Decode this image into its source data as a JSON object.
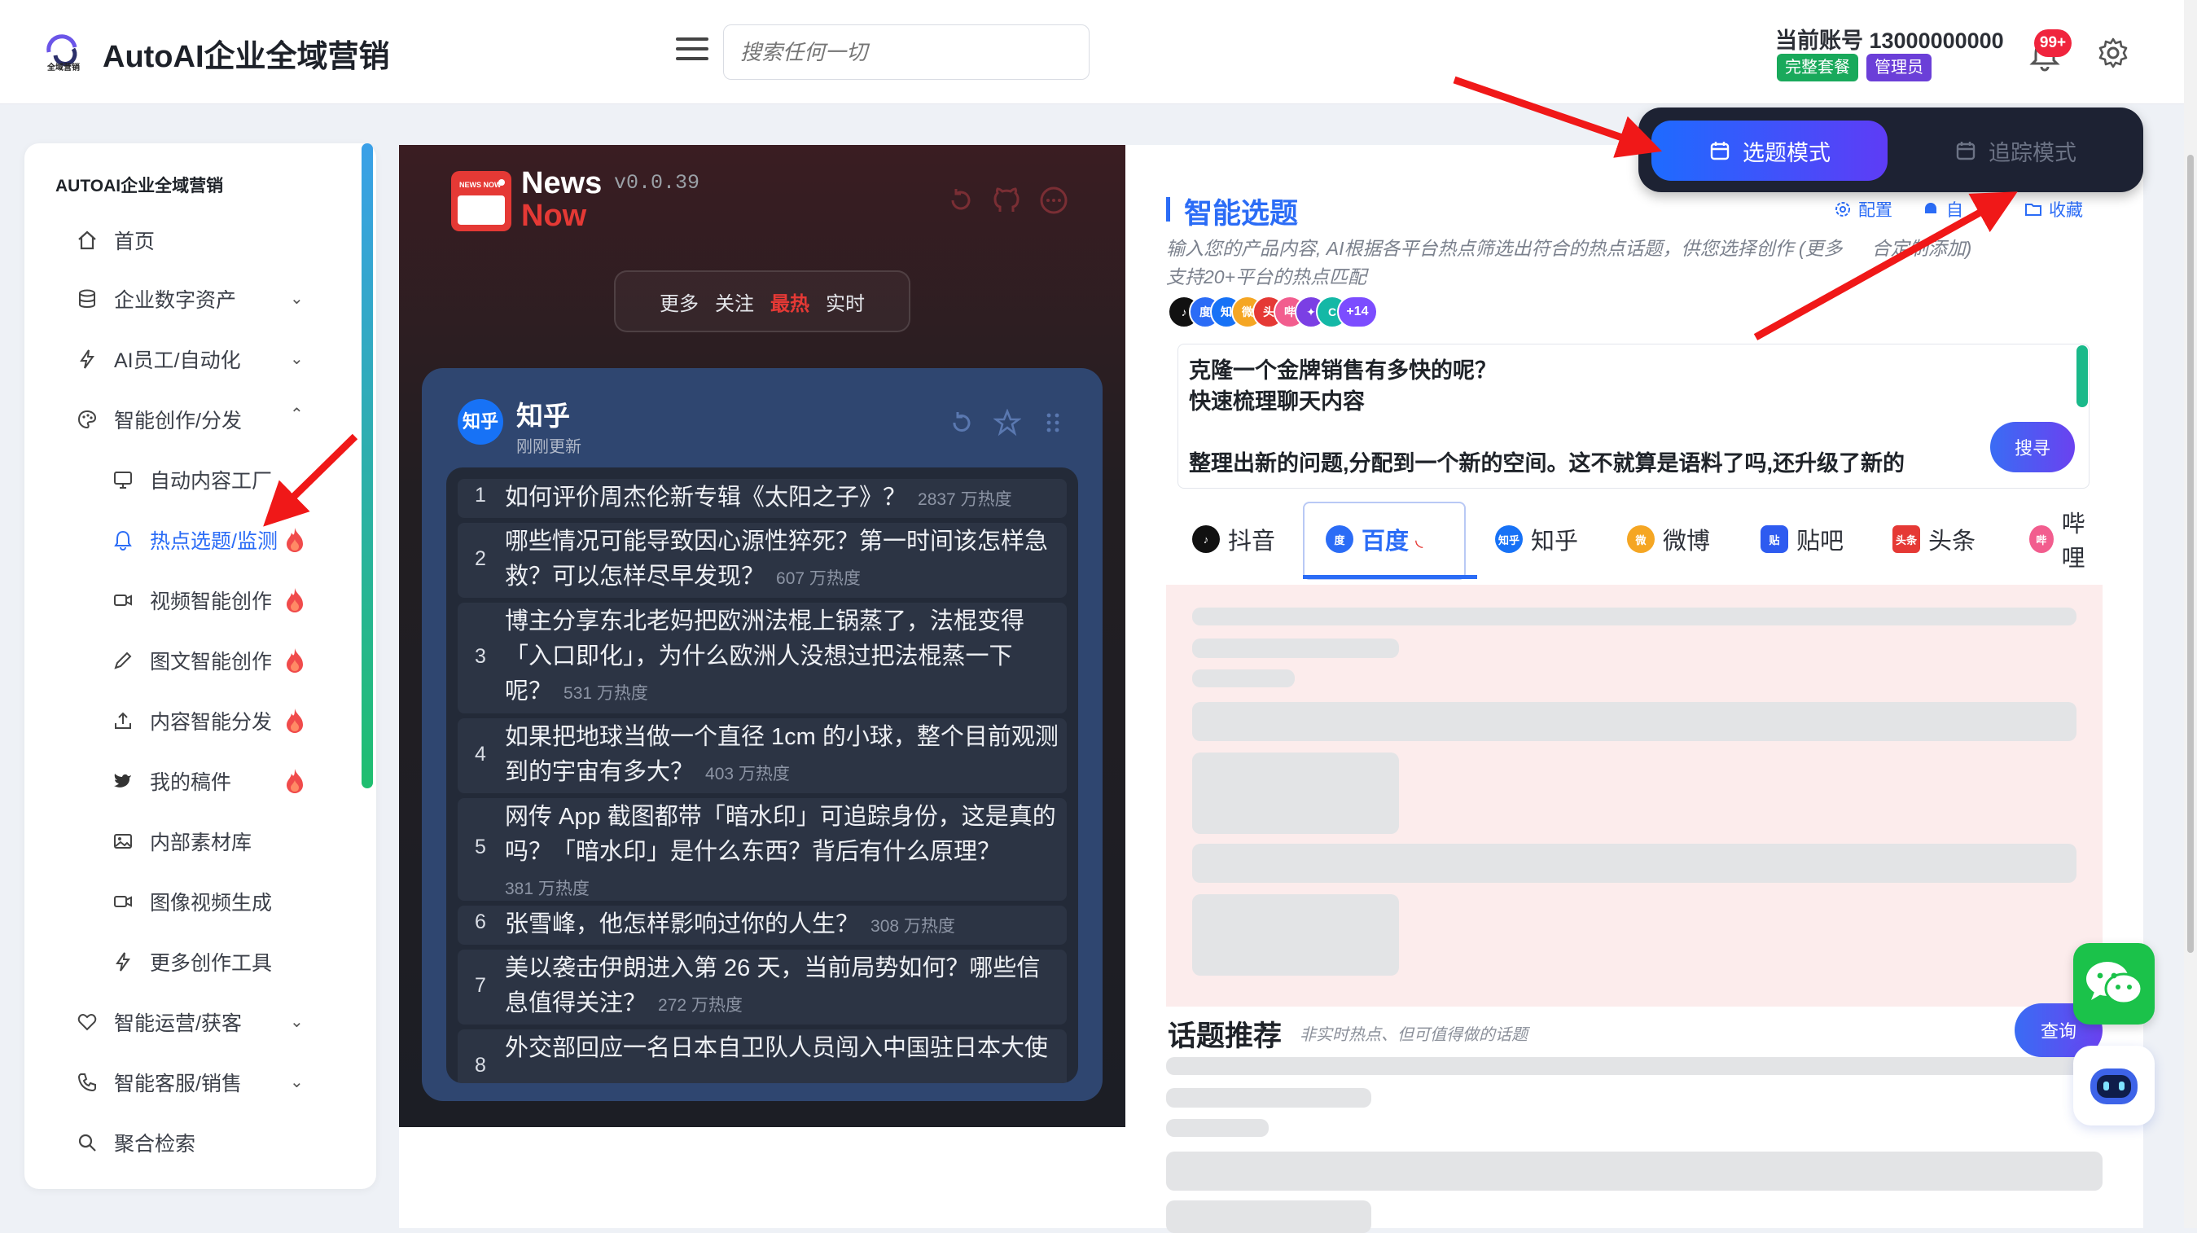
{
  "header": {
    "app_title": "AutoAI企业全域营销",
    "logo_text": "全域营销",
    "search_placeholder": "搜索任何一切",
    "account_label": "当前账号 13000000000",
    "badge_plan": "完整套餐",
    "badge_role": "管理员",
    "notification_count": "99+"
  },
  "sidebar": {
    "title": "AUTOAI企业全域营销",
    "items": [
      {
        "label": "首页",
        "icon": "home-icon"
      },
      {
        "label": "企业数字资产",
        "icon": "database-icon",
        "expandable": true
      },
      {
        "label": "AI员工/自动化",
        "icon": "bolt-icon",
        "expandable": true
      },
      {
        "label": "智能创作/分发",
        "icon": "palette-icon",
        "expanded": true
      },
      {
        "label": "自动内容工厂",
        "icon": "monitor-icon",
        "sub": true
      },
      {
        "label": "热点选题/监测",
        "icon": "bell-icon",
        "sub": true,
        "active": true,
        "hot": true
      },
      {
        "label": "视频智能创作",
        "icon": "video-icon",
        "sub": true,
        "hot": true
      },
      {
        "label": "图文智能创作",
        "icon": "pen-icon",
        "sub": true,
        "hot": true
      },
      {
        "label": "内容智能分发",
        "icon": "upload-icon",
        "sub": true,
        "hot": true
      },
      {
        "label": "我的稿件",
        "icon": "bird-icon",
        "sub": true,
        "hot": true
      },
      {
        "label": "内部素材库",
        "icon": "image-icon",
        "sub": true
      },
      {
        "label": "图像视频生成",
        "icon": "video-icon",
        "sub": true
      },
      {
        "label": "更多创作工具",
        "icon": "bolt-icon",
        "sub": true
      },
      {
        "label": "智能运营/获客",
        "icon": "heart-icon",
        "expandable": true
      },
      {
        "label": "智能客服/销售",
        "icon": "phone-icon",
        "expandable": true
      },
      {
        "label": "聚合检索",
        "icon": "search-icon"
      }
    ]
  },
  "news": {
    "brand_line1": "News",
    "brand_line2": "Now",
    "brand_badge": "NEWS NOW",
    "version": "v0.0.39",
    "tabs": [
      "更多",
      "关注",
      "最热",
      "实时"
    ],
    "active_tab": "最热",
    "source_badge": "知乎",
    "source_name": "知乎",
    "updated": "刚刚更新",
    "items": [
      {
        "num": "1",
        "title": "如何评价周杰伦新专辑《太阳之子》？",
        "heat": "2837 万热度"
      },
      {
        "num": "2",
        "title": "哪些情况可能导致因心源性猝死？第一时间该怎样急救？可以怎样尽早发现？",
        "heat": "607 万热度"
      },
      {
        "num": "3",
        "title": "博主分享东北老妈把欧洲法棍上锅蒸了，法棍变得「入口即化」，为什么欧洲人没想过把法棍蒸一下呢？",
        "heat": "531 万热度"
      },
      {
        "num": "4",
        "title": "如果把地球当做一个直径 1cm 的小球，整个目前观测到的宇宙有多大？",
        "heat": "403 万热度"
      },
      {
        "num": "5",
        "title": "网传 App 截图都带「暗水印」可追踪身份，这是真的吗？「暗水印」是什么东西？背后有什么原理？",
        "heat": "381 万热度"
      },
      {
        "num": "6",
        "title": "张雪峰，他怎样影响过你的人生？",
        "heat": "308 万热度"
      },
      {
        "num": "7",
        "title": "美以袭击伊朗进入第 26 天，当前局势如何？哪些信息值得关注？",
        "heat": "272 万热度"
      },
      {
        "num": "8",
        "title": "外交部回应一名日本自卫队人员闯入中国驻日本大使",
        "heat": ""
      }
    ]
  },
  "right": {
    "mode_select": "选题模式",
    "mode_track": "追踪模式",
    "title": "智能选题",
    "tool_config": "配置",
    "tool_more": "自",
    "tool_fav": "收藏",
    "desc_line1": "输入您的产品内容, AI根据各平台热点筛选出符合的热点话题，供您选择创作 (更多",
    "desc_line1_tail": "合定制添加)",
    "desc_line2": "支持20+平台的热点匹配",
    "platform_more": "+14",
    "input_text": "克隆一个金牌销售有多快的呢？\n快速梳理聊天内容\n\n整理出新的问题,分配到一个新的空间。这不就算是语料了吗,还升级了新的",
    "search_button": "搜寻",
    "platform_tabs": [
      {
        "label": "抖音",
        "icon": "douyin-icon",
        "color": "#111111"
      },
      {
        "label": "百度",
        "icon": "baidu-icon",
        "color": "#2b6cf6"
      },
      {
        "label": "知乎",
        "icon": "zhihu-icon",
        "color": "#1772f6"
      },
      {
        "label": "微博",
        "icon": "weibo-icon",
        "color": "#f5a623"
      },
      {
        "label": "贴吧",
        "icon": "tieba-icon",
        "color": "#2e5bf0"
      },
      {
        "label": "头条",
        "icon": "toutiao-icon",
        "color": "#e53935"
      },
      {
        "label": "哔哩",
        "icon": "bilibili-icon",
        "color": "#f25d8e"
      }
    ],
    "active_platform": "百度",
    "rec_title": "话题推荐",
    "rec_subtitle": "非实时热点、但可值得做的话题",
    "query_button": "查询"
  },
  "colors": {
    "accent": "#2b6cf6",
    "hot": "#e53935",
    "plan_badge": "#19a95b",
    "admin_badge": "#6b3fd8"
  }
}
